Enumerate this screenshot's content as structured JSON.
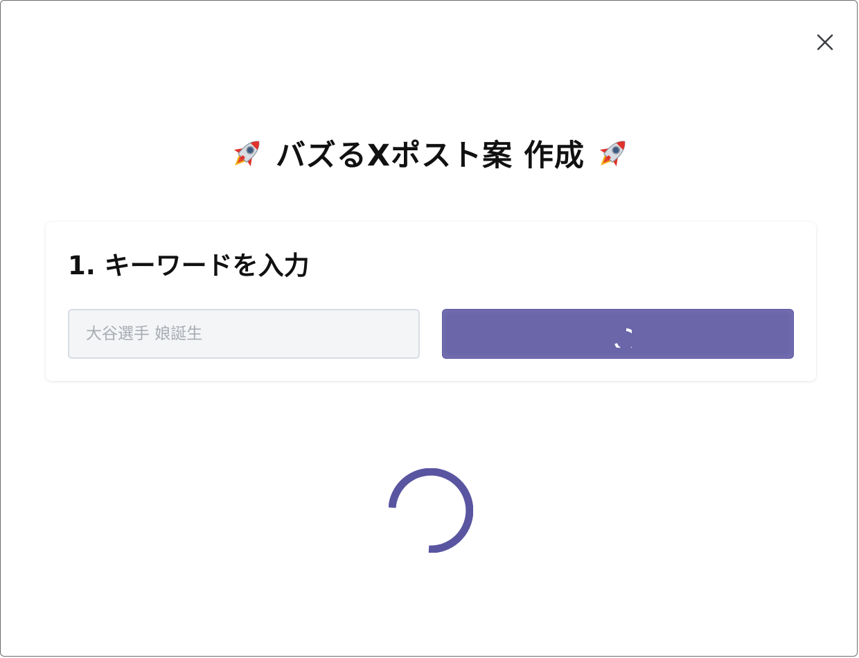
{
  "dialog": {
    "close_icon": "close-icon",
    "title_text": "バズるXポスト案 作成",
    "title_icon": "rocket-icon"
  },
  "keyword_step": {
    "heading": "1. キーワードを入力",
    "input": {
      "value": "",
      "placeholder": "大谷選手 娘誕生"
    },
    "submit_button": {
      "state": "loading",
      "icon": "spinner-icon"
    }
  },
  "loading_indicator": {
    "state": "loading",
    "icon": "spinner-icon"
  },
  "colors": {
    "accent": "#6b66aa",
    "spinner": "#5a55a0",
    "input_bg": "#f3f5f7",
    "input_border": "#d7dde4",
    "title_text": "#111111"
  }
}
